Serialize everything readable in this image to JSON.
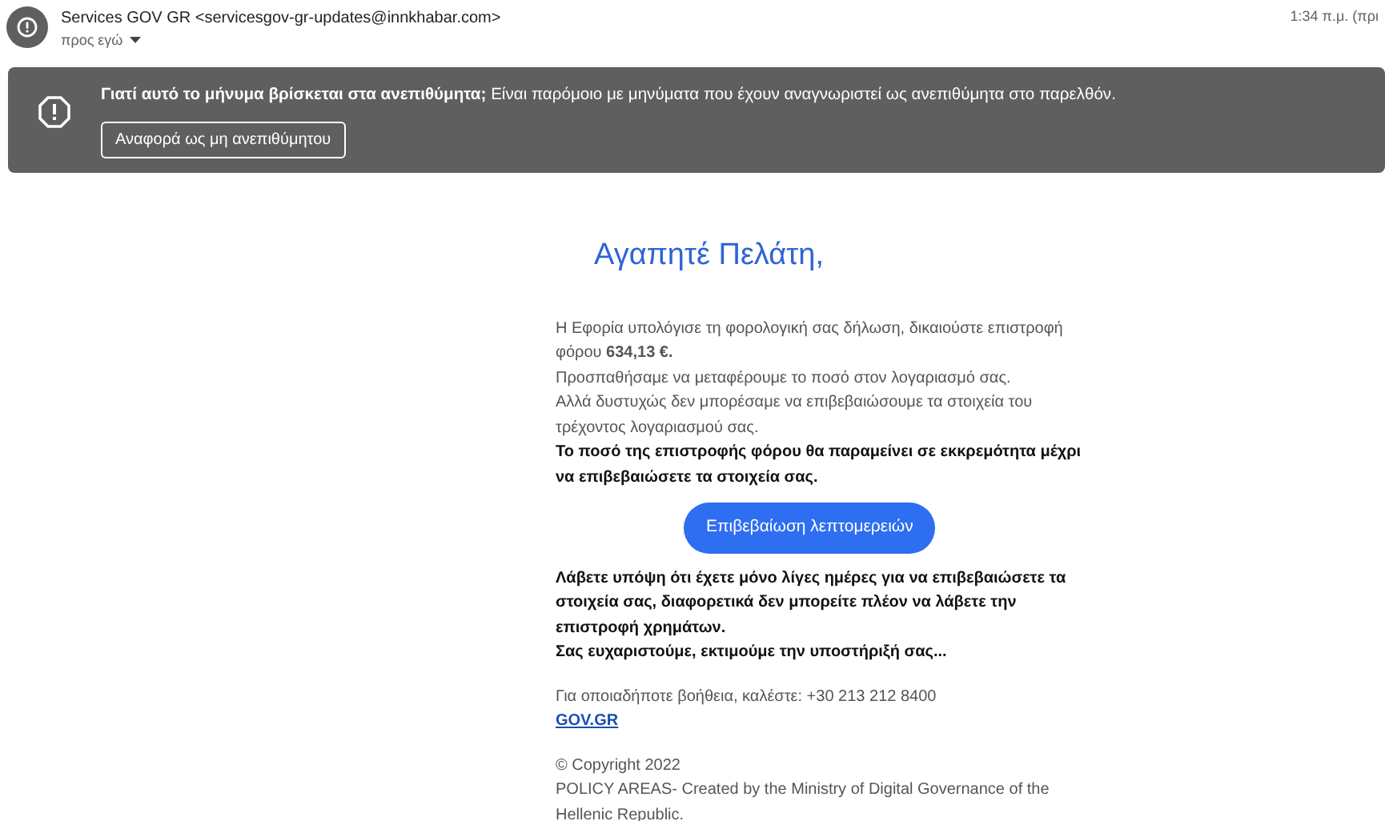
{
  "header": {
    "sender": "Services GOV GR <servicesgov-gr-updates@innkhabar.com>",
    "recipient": "προς εγώ",
    "time": "1:34 π.μ. (πρι"
  },
  "spam_banner": {
    "message": "**Γιατί αυτό το μήνυμα βρίσκεται στα ανεπιθύμητα;** Είναι παρόμοιο με μηνύματα που έχουν αναγνωριστεί ως ανεπιθύμητα στο παρελθόν.",
    "button": "Αναφορά ως μη ανεπιθύμητου"
  },
  "email": {
    "greeting": "Αγαπητέ Πελάτη,",
    "intro": [
      {
        "kind": "normal",
        "text": "Η Εφορία υπολόγισε τη φορολογική σας δήλωση, δικαιούστε επιστροφή φόρου **634,13 €.**"
      },
      {
        "kind": "normal",
        "text": "Προσπαθήσαμε να μεταφέρουμε το ποσό στον λογαριασμό σας."
      },
      {
        "kind": "normal",
        "text": "Αλλά δυστυχώς δεν μπορέσαμε να επιβεβαιώσουμε τα στοιχεία του τρέχοντος λογαριασμού σας."
      },
      {
        "kind": "bold",
        "text": "Το ποσό της επιστροφής φόρου θα παραμείνει σε εκκρεμότητα μέχρι να επιβεβαιώσετε τα στοιχεία σας."
      }
    ],
    "button": "Επιβεβαίωση λεπτομερειών",
    "outro": [
      {
        "kind": "bold",
        "text": "Λάβετε υπόψη ότι έχετε μόνο λίγες ημέρες για να επιβεβαιώσετε τα στοιχεία σας, διαφορετικά δεν μπορείτε πλέον να λάβετε την επιστροφή χρημάτων."
      },
      {
        "kind": "bold",
        "text": "Σας ευχαριστούμε, εκτιμούμε την υποστήριξή σας..."
      }
    ],
    "help": "Για οποιαδήποτε βοήθεια, καλέστε: +30 213 212 8400",
    "link": "GOV.GR",
    "copyright": "© Copyright 2022",
    "footer": "POLICY AREAS- Created by the Ministry of Digital Governance of the Hellenic Republic."
  }
}
